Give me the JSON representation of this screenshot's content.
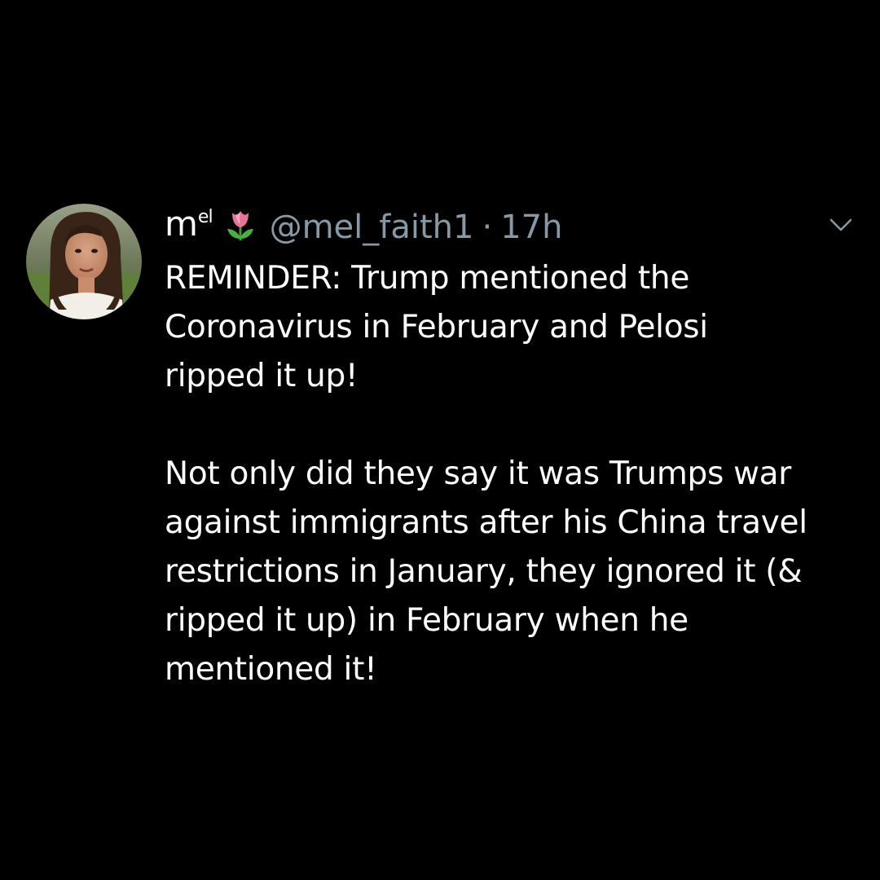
{
  "tweet": {
    "display_name": "m",
    "display_name_sup": "el",
    "name_emoji": "tulip-emoji",
    "handle": "@mel_faith1",
    "separator": "·",
    "time": "17h",
    "menu_icon": "chevron-down-icon",
    "paragraphs": [
      "REMINDER: Trump mentioned the\nCoronavirus in February and Pelosi\nripped it up!",
      "Not only did they say it was Trumps war\nagainst immigrants after his China travel\nrestrictions in January, they ignored it (&\nripped it up) in February when he\nmentioned it!"
    ]
  },
  "colors": {
    "background": "#000000",
    "text": "#ffffff",
    "secondary": "#8899a6"
  }
}
